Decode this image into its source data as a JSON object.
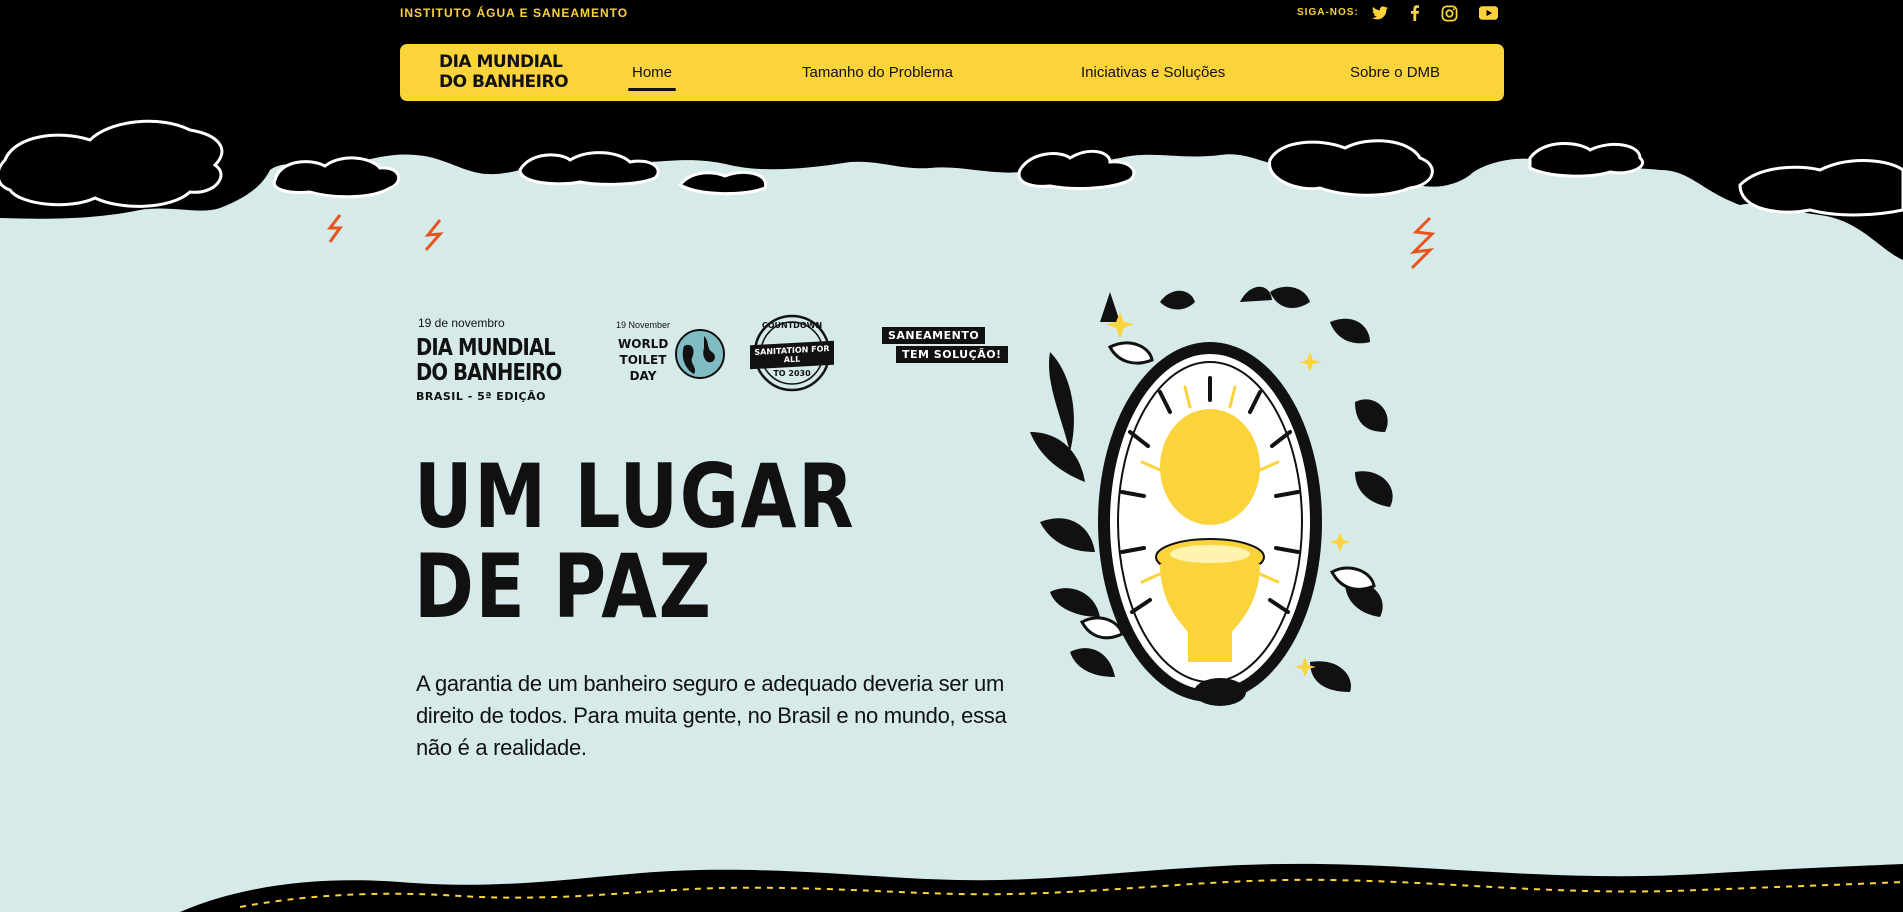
{
  "header": {
    "institute": "INSTITUTO ÁGUA E SANEAMENTO",
    "follow_label": "SIGA-NOS:",
    "social": [
      {
        "name": "twitter-icon"
      },
      {
        "name": "facebook-icon"
      },
      {
        "name": "instagram-icon"
      },
      {
        "name": "youtube-icon"
      }
    ]
  },
  "nav": {
    "logo_line1": "DIA MUNDIAL",
    "logo_line2": "DO BANHEIRO",
    "items": [
      {
        "label": "Home",
        "active": true
      },
      {
        "label": "Tamanho do Problema"
      },
      {
        "label": "Iniciativas e Soluções"
      },
      {
        "label": "Sobre o DMB"
      }
    ]
  },
  "hero": {
    "date": "19 de novembro",
    "logo_line1": "DIA MUNDIAL",
    "logo_line2": "DO BANHEIRO",
    "edition": "BRASIL - 5ª EDIÇÃO",
    "wtd_date": "19 November",
    "wtd_line1": "WORLD",
    "wtd_line2": "TOILET",
    "wtd_line3": "DAY",
    "stamp_top": "COUNTDOWN",
    "stamp_center": "SANITATION FOR ALL",
    "stamp_bottom": "TO 2030",
    "tag_line1": "SANEAMENTO",
    "tag_line2": "TEM SOLUÇÃO!",
    "headline_line1": "UM LUGAR",
    "headline_line2": "DE PAZ",
    "body": "A garantia de um banheiro seguro e adequado deveria ser um direito de todos. Para muita gente, no Brasil e no mundo, essa não é a realidade."
  },
  "colors": {
    "yellow": "#fbd33b",
    "black": "#000000",
    "background": "#d6eae9",
    "accent": "#e8541e"
  }
}
